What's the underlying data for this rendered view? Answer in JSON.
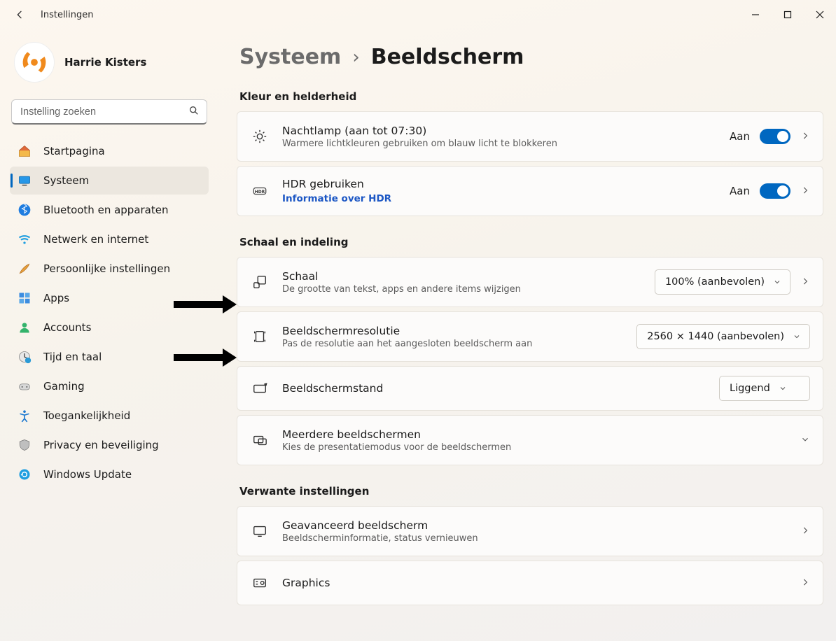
{
  "app_title": "Instellingen",
  "user": {
    "name": "Harrie Kisters"
  },
  "search": {
    "placeholder": "Instelling zoeken"
  },
  "sidebar": {
    "items": [
      {
        "label": "Startpagina"
      },
      {
        "label": "Systeem"
      },
      {
        "label": "Bluetooth en apparaten"
      },
      {
        "label": "Netwerk en internet"
      },
      {
        "label": "Persoonlijke instellingen"
      },
      {
        "label": "Apps"
      },
      {
        "label": "Accounts"
      },
      {
        "label": "Tijd en taal"
      },
      {
        "label": "Gaming"
      },
      {
        "label": "Toegankelijkheid"
      },
      {
        "label": "Privacy en beveiliging"
      },
      {
        "label": "Windows Update"
      }
    ]
  },
  "breadcrumb": {
    "level1": "Systeem",
    "level2": "Beeldscherm"
  },
  "sections": {
    "brightness": {
      "heading": "Kleur en helderheid",
      "nightlight": {
        "title": "Nachtlamp (aan tot 07:30)",
        "sub": "Warmere lichtkleuren gebruiken om blauw licht te blokkeren",
        "status": "Aan"
      },
      "hdr": {
        "title": "HDR gebruiken",
        "link": "Informatie over HDR",
        "status": "Aan"
      }
    },
    "scale": {
      "heading": "Schaal en indeling",
      "schaal": {
        "title": "Schaal",
        "sub": "De grootte van tekst, apps en andere items wijzigen",
        "value": "100% (aanbevolen)"
      },
      "resolution": {
        "title": "Beeldschermresolutie",
        "sub": "Pas de resolutie aan het aangesloten beeldscherm aan",
        "value": "2560 × 1440 (aanbevolen)"
      },
      "orientation": {
        "title": "Beeldschermstand",
        "value": "Liggend"
      },
      "multi": {
        "title": "Meerdere beeldschermen",
        "sub": "Kies de presentatiemodus voor de beeldschermen"
      }
    },
    "related": {
      "heading": "Verwante instellingen",
      "advanced": {
        "title": "Geavanceerd beeldscherm",
        "sub": "Beeldscherminformatie, status vernieuwen"
      },
      "graphics": {
        "title": "Graphics"
      }
    }
  }
}
